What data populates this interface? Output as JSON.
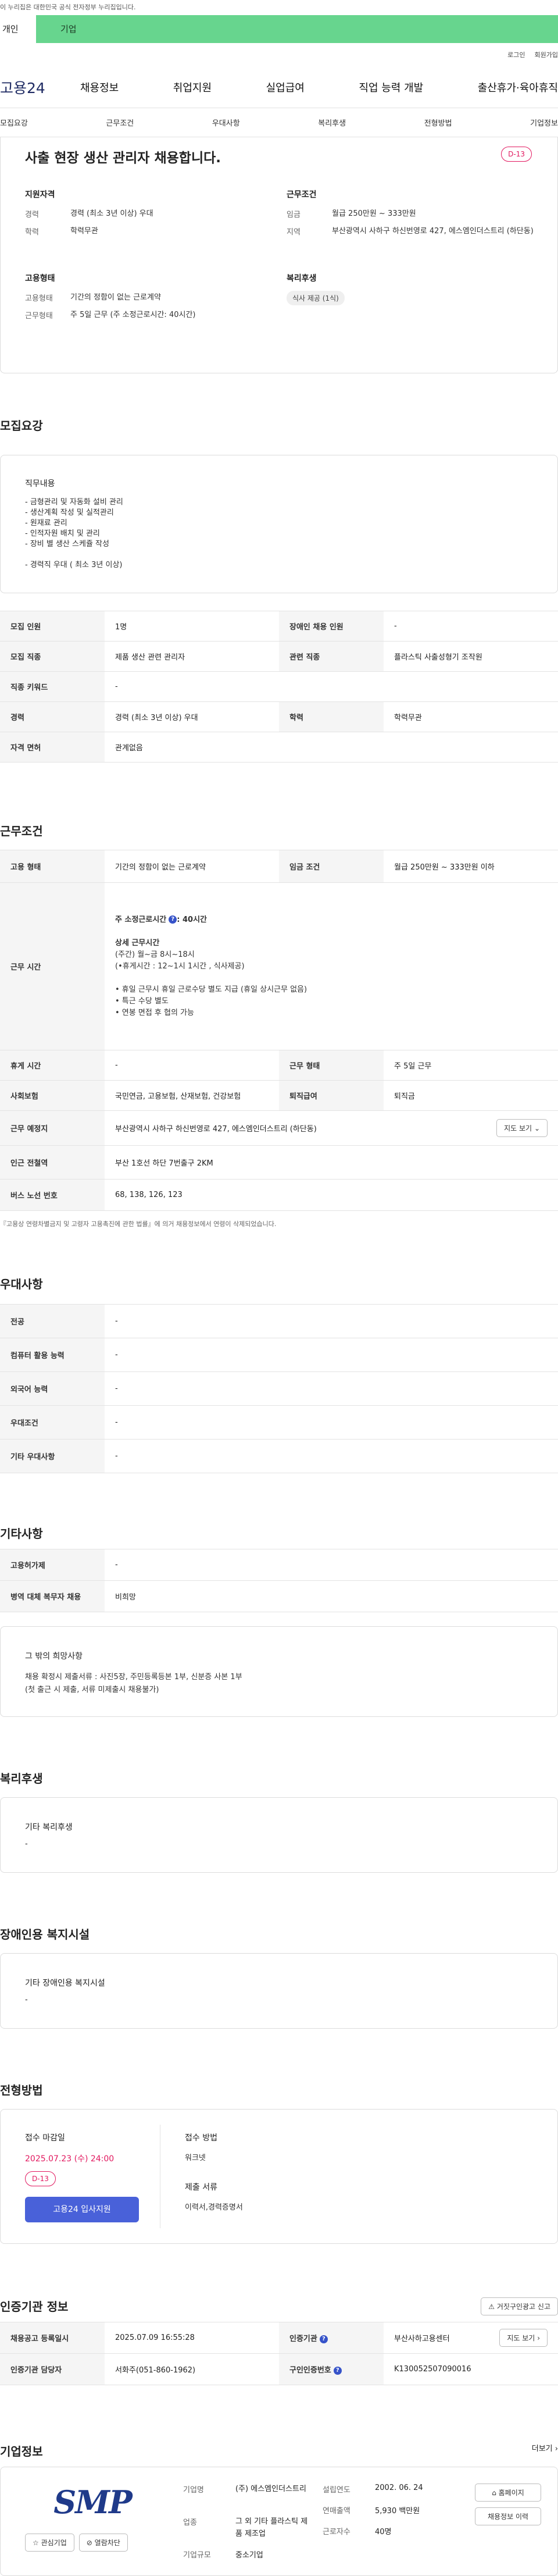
{
  "topbar": {
    "notice": "이 누리집은 대한민국 공식 전자정부 누리집입니다."
  },
  "user_tabs": {
    "individual": "개인",
    "enterprise": "기업"
  },
  "util": {
    "login": "로그인",
    "signup": "회원가입"
  },
  "gnb": {
    "logo": "고용24",
    "items": [
      "채용정보",
      "취업지원",
      "실업급여",
      "직업 능력 개발",
      "출산휴가·육아휴직"
    ]
  },
  "subnav": [
    "모집요강",
    "근무조건",
    "우대사항",
    "복리후생",
    "전형방법",
    "기업정보"
  ],
  "hero": {
    "title": "사출 현장 생산 관리자 채용합니다.",
    "dday": "D-13",
    "qualification": {
      "heading": "지원자격",
      "career_label": "경력",
      "career_value": "경력 (최소 3년 이상) 우대",
      "edu_label": "학력",
      "edu_value": "학력무관"
    },
    "conditions": {
      "heading": "근무조건",
      "wage_label": "임금",
      "wage_value": "월급 250만원 ~ 333만원",
      "region_label": "지역",
      "region_value": "부산광역시 사하구 하신번영로 427, 에스엠인더스트리 (하단동)"
    },
    "employment": {
      "heading": "고용형태",
      "type_label": "고용형태",
      "type_value": "기간의 정함이 없는 근로계약",
      "hours_label": "근무형태",
      "hours_value": "주 5일 근무 (주 소정근로시간: 40시간)"
    },
    "welfare": {
      "heading": "복리후생",
      "badge": "식사 제공 (1식)"
    }
  },
  "recruit": {
    "title": "모집요강",
    "duty_heading": "직무내용",
    "duty_lines": [
      "- 금형관리 및 자동화 설비 관리",
      "- 생산계획 작성 및 실적관리",
      "- 원재료 관리",
      "- 인적자원 배치 및 관리",
      "- 장비 별 생산 스케쥴 작성",
      "",
      "- 경력직 우대 ( 최소 3년 이상)"
    ],
    "rows": [
      {
        "k1": "모집 인원",
        "v1": "1명",
        "k2": "장애인 채용 인원",
        "v2": "-"
      },
      {
        "k1": "모집 직종",
        "v1": "제품 생산 관련 관리자",
        "k2": "관련 직종",
        "v2": "플라스틱 사출성형기 조작원"
      },
      {
        "k1": "직종 키워드",
        "v1": "-"
      },
      {
        "k1": "경력",
        "v1": "경력 (최소 3년 이상) 우대",
        "k2": "학력",
        "v2": "학력무관"
      },
      {
        "k1": "자격 면허",
        "v1": "관계없음"
      }
    ]
  },
  "workcond": {
    "title": "근무조건",
    "employ_label": "고용 형태",
    "employ_value": "기간의 정함이 없는 근로계약",
    "wage_label": "임금 조건",
    "wage_value": "월급 250만원 ~ 333만원 이하",
    "hours_label": "근무 시간",
    "hours_total": "주 소정근로시간",
    "hours_total_value": ": 40시간",
    "hours_lines": [
      "상세 근무시간",
      "(주간) 월~금 8시~18시",
      "(•휴게시간 : 12~1시 1시간 ,  식사제공)",
      "",
      "• 휴일 근무시 휴일 근로수당 별도 지급 (휴일 상시근무 없음)",
      "• 특근 수당 별도",
      "• 연봉 면접 후 협의 가능"
    ],
    "rest_label": "휴게 시간",
    "rest_value": "-",
    "form_label": "근무 형태",
    "form_value": "주 5일 근무",
    "ins_label": "사회보험",
    "ins_value": "국민연금, 고용보험, 산재보험, 건강보험",
    "sev_label": "퇴직급여",
    "sev_value": "퇴직금",
    "place_label": "근무 예정지",
    "place_value": "부산광역시 사하구 하신번영로 427, 에스엠인더스트리 (하단동)",
    "map_btn": "지도 보기",
    "subway_label": "인근 전철역",
    "subway_value": "부산 1호선 하단 7번출구 2KM",
    "bus_label": "버스 노선 번호",
    "bus_value": "68, 138, 126, 123",
    "footnote": "『고용상 연령차별금지 및 고령자 고용촉진에 관한 법률』에 의거 채용정보에서 연령이 삭제되었습니다."
  },
  "prefer": {
    "title": "우대사항",
    "rows": [
      {
        "k": "전공",
        "v": "-"
      },
      {
        "k": "컴퓨터 활용 능력",
        "v": "-"
      },
      {
        "k": "외국어 능력",
        "v": "-"
      },
      {
        "k": "우대조건",
        "v": "-"
      },
      {
        "k": "기타 우대사항",
        "v": "-"
      }
    ]
  },
  "etc": {
    "title": "기타사항",
    "rows": [
      {
        "k": "고용허가제",
        "v": "-"
      },
      {
        "k": "병역 대체 복무자 채용",
        "v": "비희망"
      }
    ],
    "extra_heading": "그 밖의 희망사항",
    "extra_lines": [
      "채용 확정시 제출서류 : 사진5장, 주민등록등본 1부, 신분증 사본 1부",
      "(첫 출근 시 제출, 서류 미제출시 채용불가)"
    ]
  },
  "welfare": {
    "title": "복리후생",
    "box_heading": "기타 복리후생",
    "box_value": "-"
  },
  "disability": {
    "title": "장애인용 복지시설",
    "box_heading": "기타 장애인용 복지시설",
    "box_value": "-"
  },
  "process": {
    "title": "전형방법",
    "deadline_label": "접수 마감일",
    "deadline_value": "2025.07.23 (수) 24:00",
    "dday": "D-13",
    "apply_btn": "고용24 입사지원",
    "method_label": "접수 방법",
    "method_value": "워크넷",
    "docs_label": "제출 서류",
    "docs_value": "이력서,경력증명서"
  },
  "cert": {
    "title": "인증기관 정보",
    "report_btn": "거짓구인광고 신고",
    "reg_label": "채용공고 등록일시",
    "reg_value": "2025.07.09 16:55:28",
    "agency_label": "인증기관",
    "agency_value": "부산사하고용센터",
    "map_btn": "지도 보기",
    "manager_label": "인증기관 담당자",
    "manager_value": "서화주(051-860-1962)",
    "cert_no_label": "구인인증번호",
    "cert_no_value": "K130052507090016"
  },
  "company": {
    "title": "기업정보",
    "more": "더보기",
    "logo_text": "SMP",
    "logo_color": "#1f3a8a",
    "interest_btn": "관심기업",
    "block_btn": "열람차단",
    "name_label": "기업명",
    "name_value": "(주) 에스엠인더스트리",
    "industry_label": "업종",
    "industry_value": "그 외 기타 플라스틱 제품 제조업",
    "scale_label": "기업규모",
    "scale_value": "중소기업",
    "founded_label": "설립연도",
    "founded_value": "2002. 06. 24",
    "sales_label": "연매출액",
    "sales_value": "5,930 백만원",
    "staff_label": "근로자수",
    "staff_value": "40명",
    "home_btn": "홈페이지",
    "jobs_btn": "채용정보 이력"
  },
  "icons": {
    "help": "question-circle-icon",
    "chevron": "chevron-right-icon",
    "home": "home-icon",
    "star": "star-icon",
    "block": "block-icon",
    "alarm": "alarm-icon"
  },
  "colors": {
    "enterprise_tab": "#67d58e",
    "dday": "#e2185f",
    "apply": "#4961d9"
  }
}
